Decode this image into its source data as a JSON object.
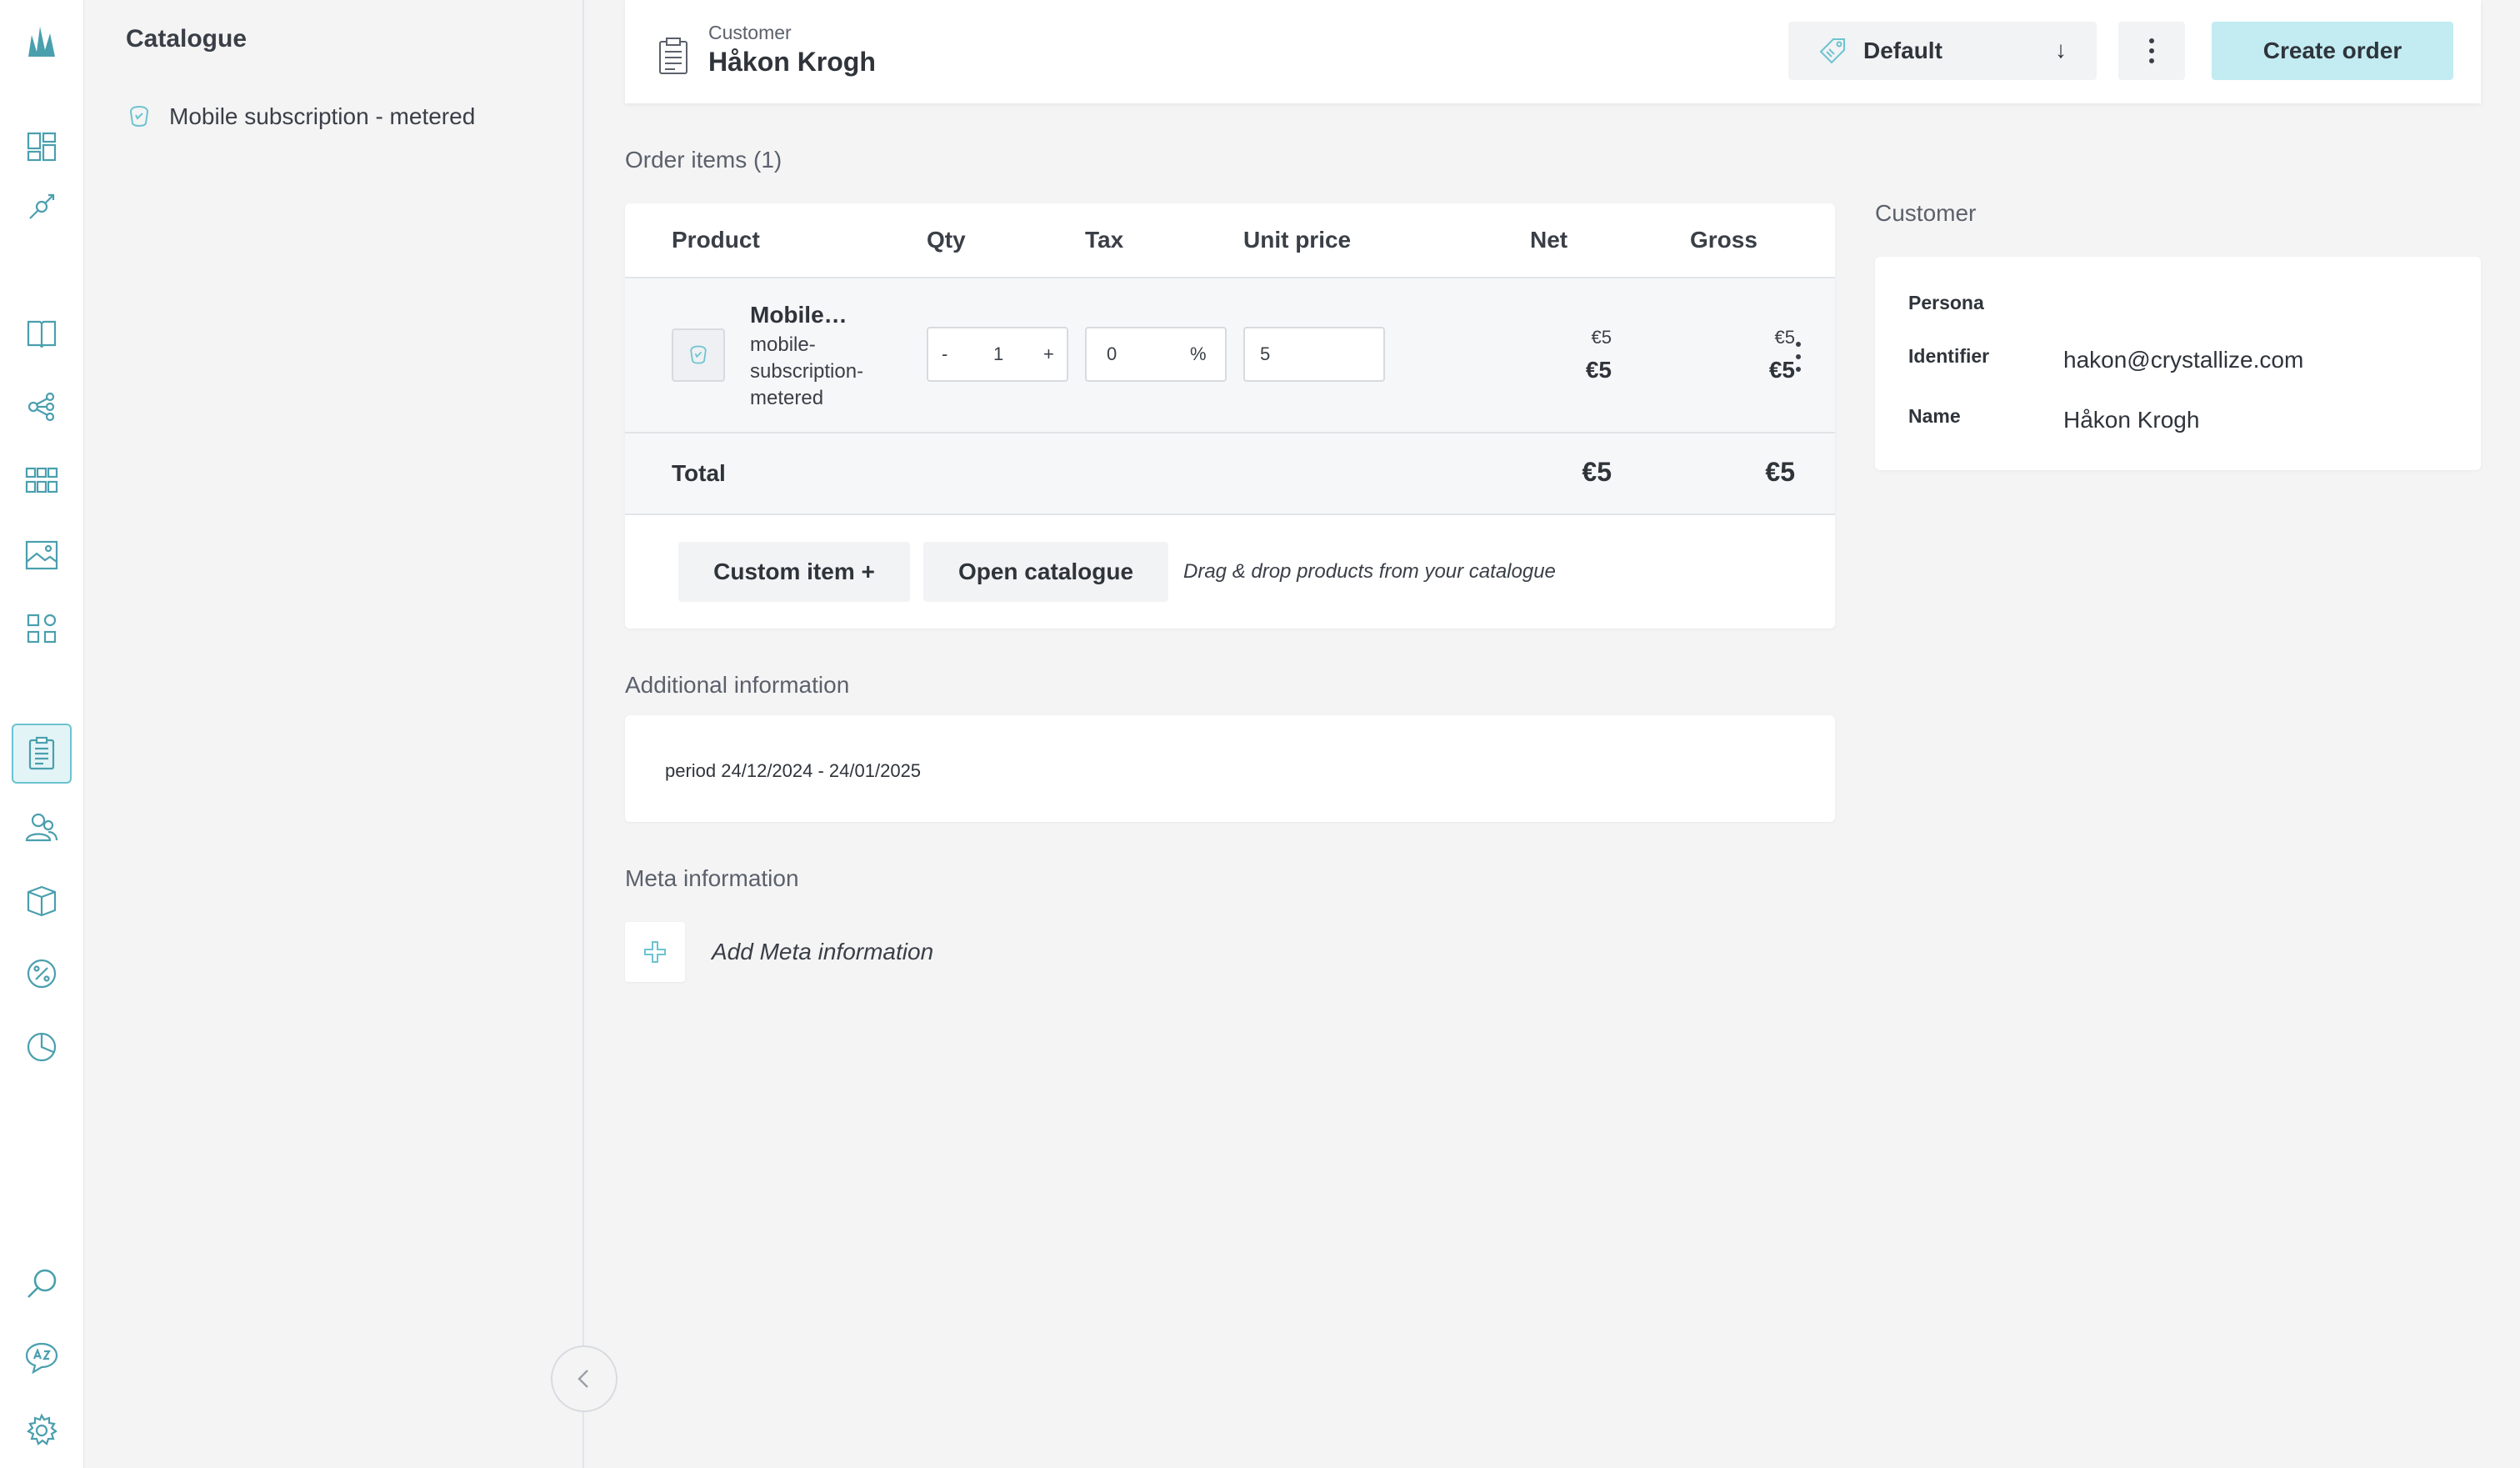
{
  "colors": {
    "accent": "#6cc3d0",
    "accent_light": "#c2ecf2",
    "background": "#f4f4f5",
    "text": "#2f343b"
  },
  "rail": {
    "icons": [
      "crystallize-logo",
      "dashboard-icon",
      "integration-icon",
      "catalogue-book-icon",
      "topics-icon",
      "grid-icon",
      "image-icon",
      "shapes-icon",
      "orders-icon",
      "customers-icon",
      "stock-icon",
      "discount-icon",
      "analytics-icon",
      "search-icon",
      "translate-icon",
      "settings-icon"
    ]
  },
  "catalogue": {
    "title": "Catalogue",
    "item_label": "Mobile subscription - metered"
  },
  "header": {
    "customer_label": "Customer",
    "customer_name": "Håkon Krogh",
    "price_variant": "Default",
    "create_label": "Create order"
  },
  "order_items": {
    "section_title": "Order items (1)",
    "columns": [
      "Product",
      "Qty",
      "Tax",
      "Unit price",
      "Net",
      "Gross"
    ],
    "rows": [
      {
        "name": "Mobile…",
        "sku": "mobile-subscription-metered",
        "qty": "1",
        "qty_minus": "-",
        "qty_plus": "+",
        "tax": "0",
        "tax_unit": "%",
        "unit_price": "5",
        "net_small": "€5",
        "net": "€5",
        "gross_small": "€5",
        "gross": "€5"
      }
    ],
    "total_label": "Total",
    "total_net": "€5",
    "total_gross": "€5",
    "custom_item_label": "Custom item +",
    "open_catalogue_label": "Open catalogue",
    "dnd_hint": "Drag & drop products from your catalogue"
  },
  "customer": {
    "section_title": "Customer",
    "persona_label": "Persona",
    "identifier_label": "Identifier",
    "identifier_value": "hakon@crystallize.com",
    "name_label": "Name",
    "name_value": "Håkon Krogh"
  },
  "additional": {
    "section_title": "Additional information",
    "text": "period 24/12/2024 - 24/01/2025"
  },
  "meta": {
    "section_title": "Meta information",
    "add_label": "Add Meta information"
  }
}
